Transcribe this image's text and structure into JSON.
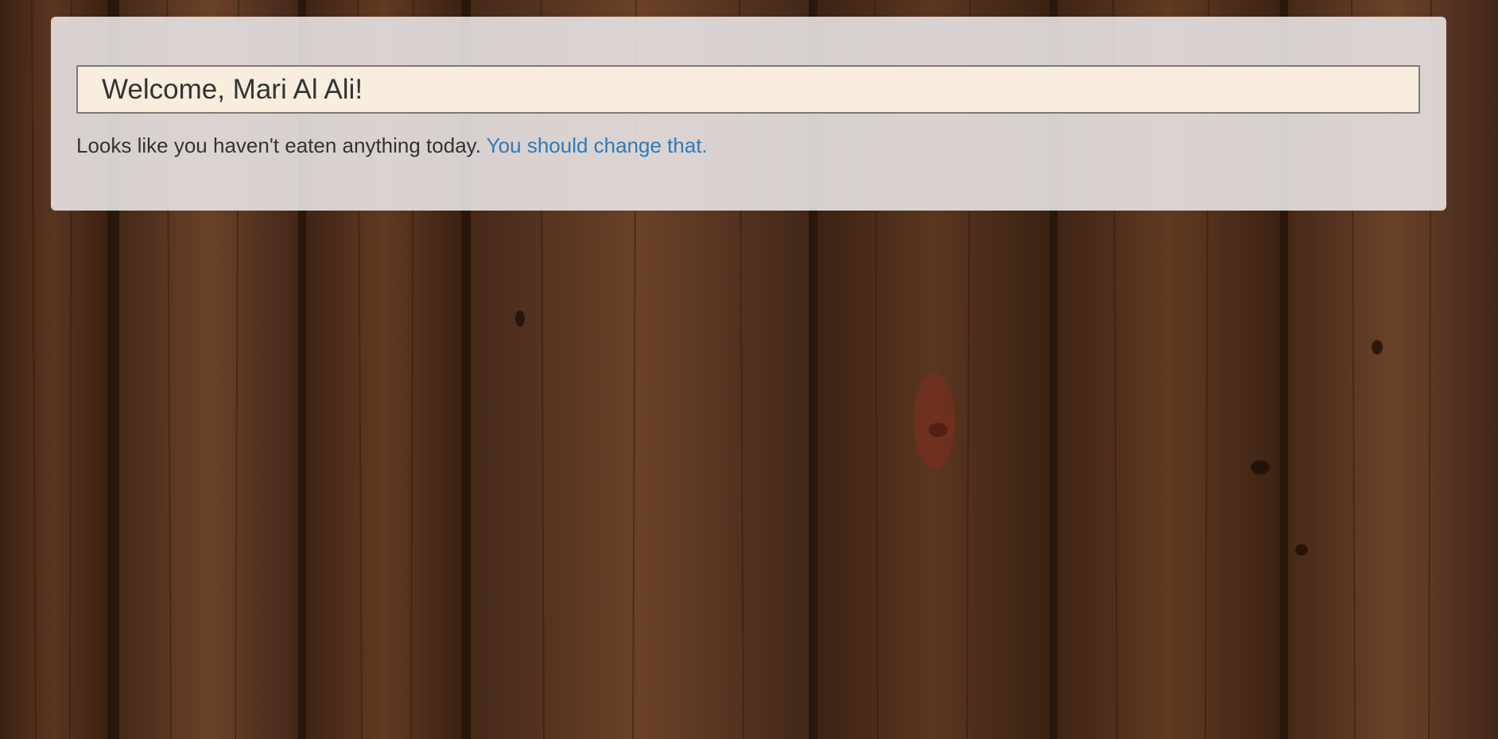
{
  "welcome": {
    "greeting": "Welcome, Mari Al Ali!"
  },
  "status": {
    "message": "Looks like you haven't eaten anything today.",
    "link_text": "You should change that."
  },
  "colors": {
    "card_background": "#ece8e9",
    "welcome_background": "#f9eddd",
    "link": "#2f7ab8",
    "text": "#333333",
    "wood": "#4a2a17"
  }
}
